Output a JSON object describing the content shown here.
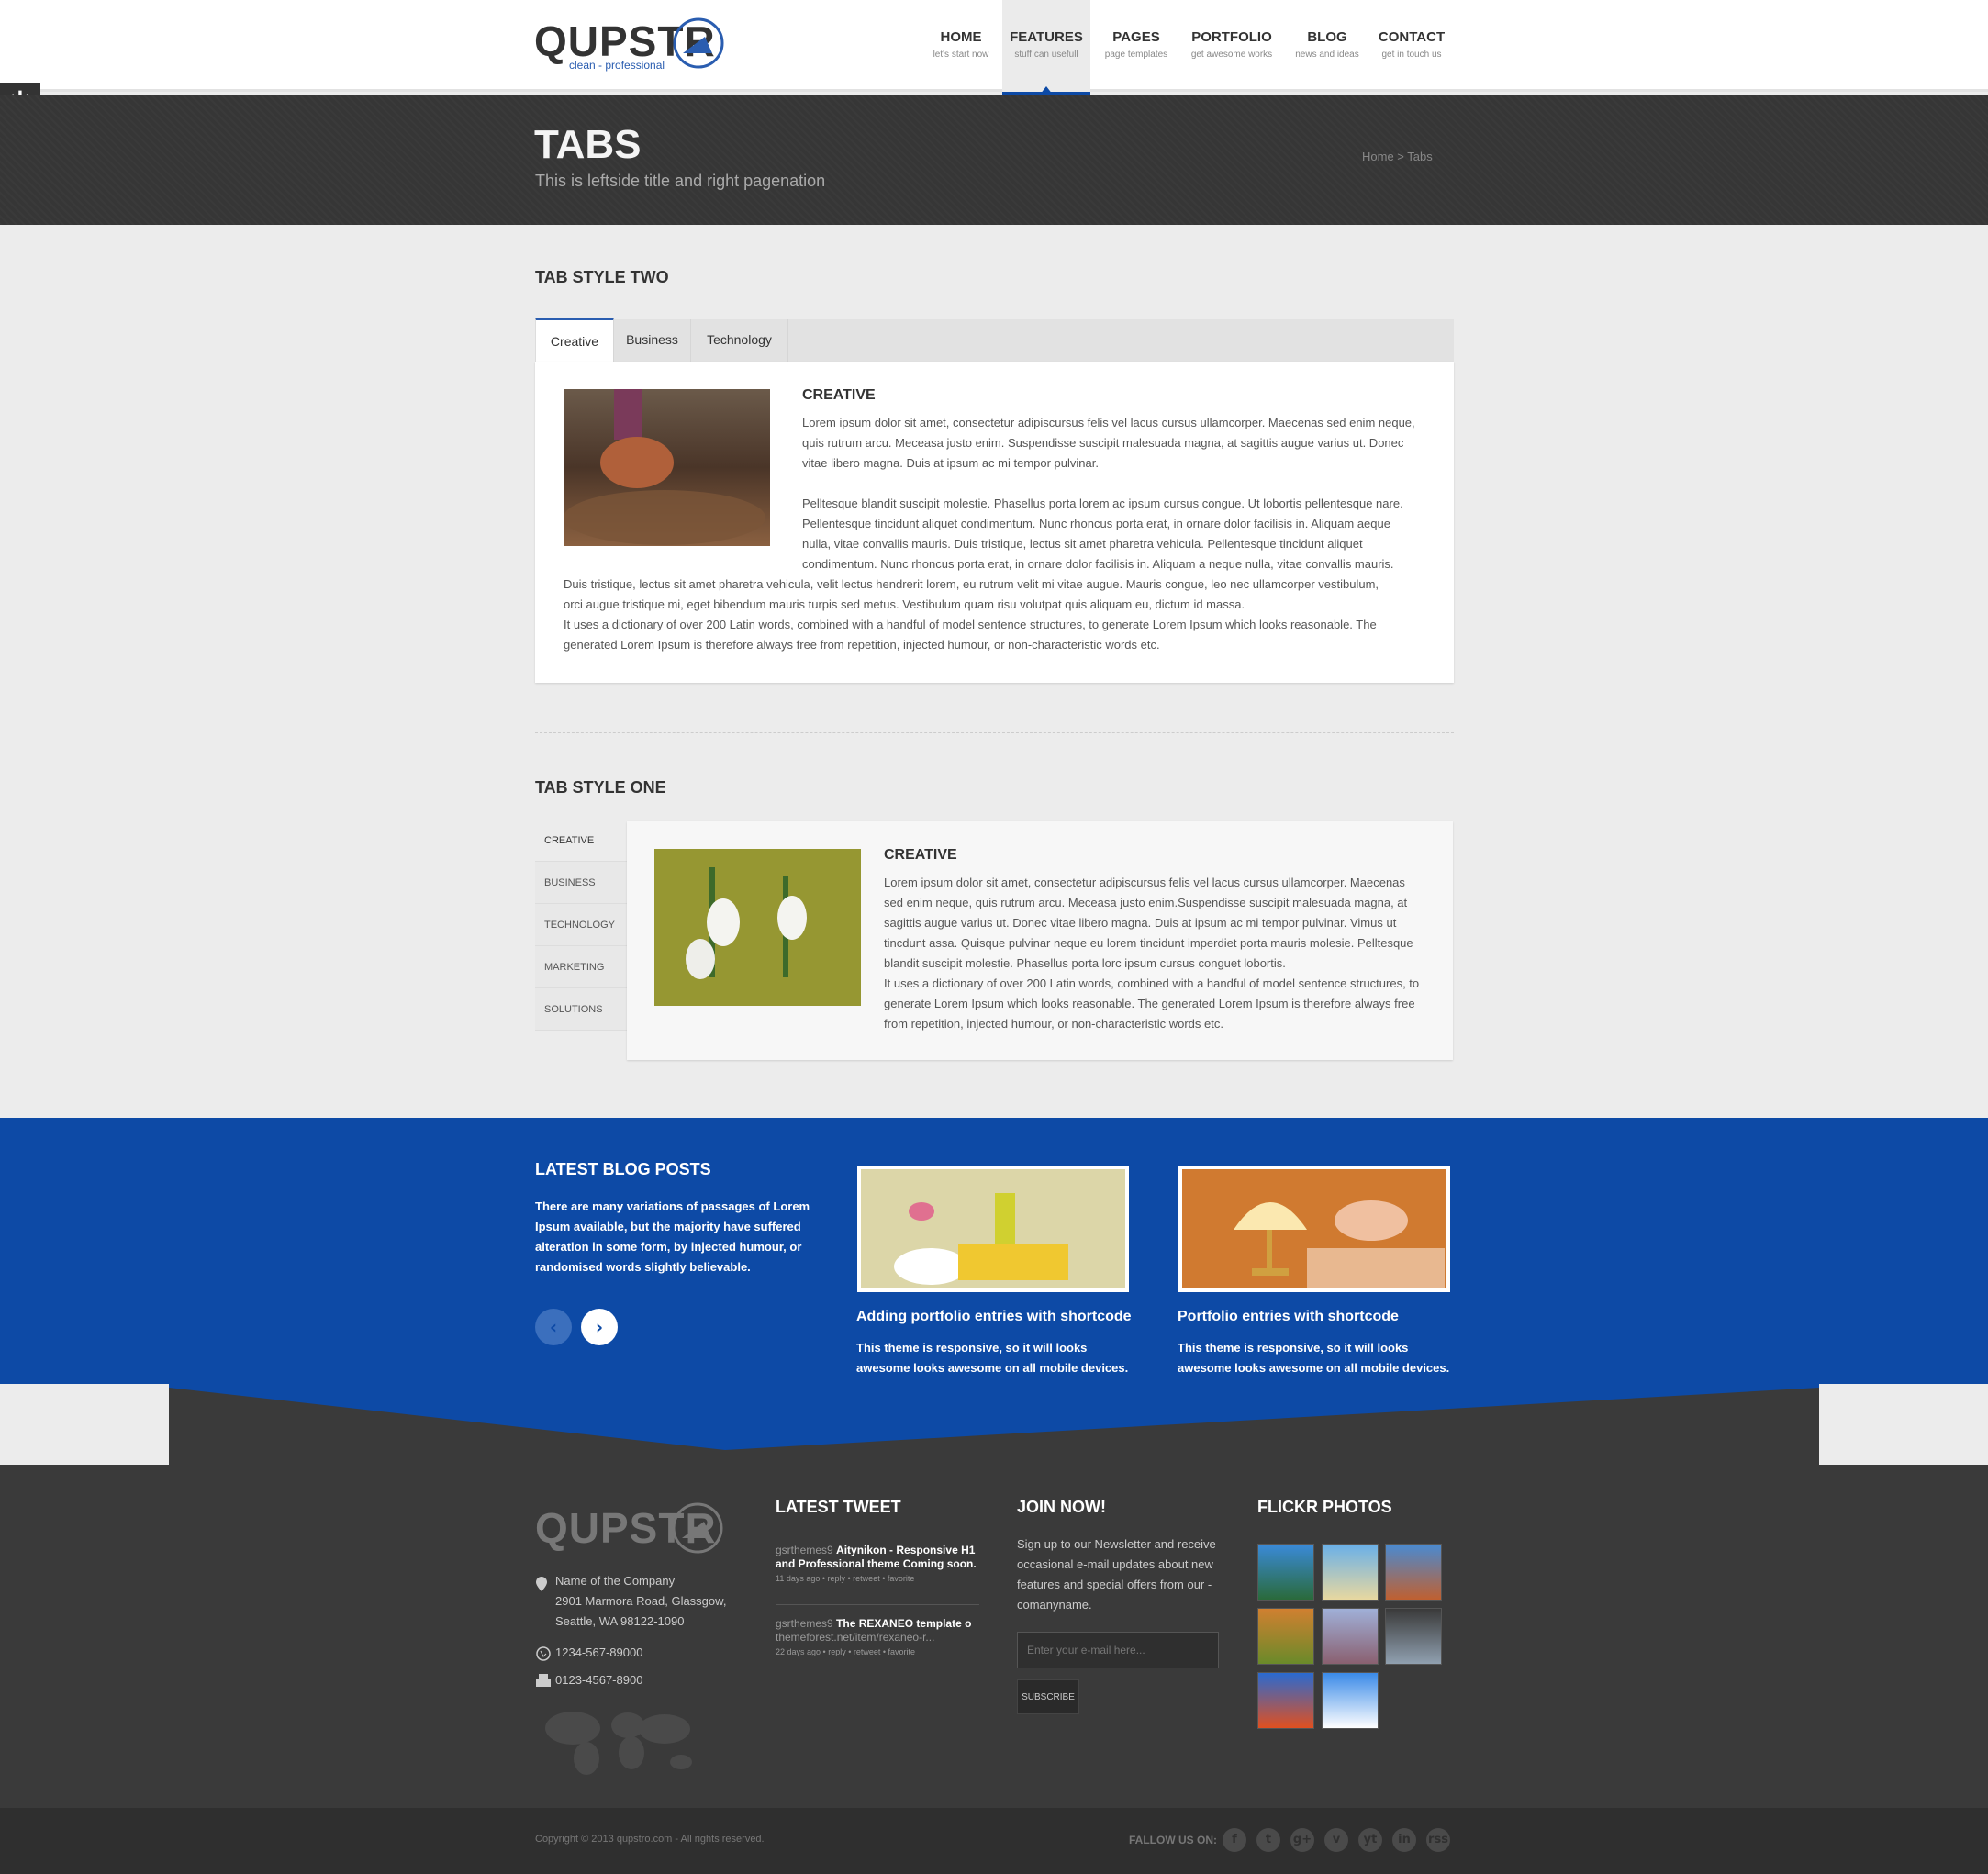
{
  "header": {
    "logo": "QUPSTR",
    "tagline": "clean - professional",
    "nav": [
      {
        "title": "HOME",
        "sub": "let's start now"
      },
      {
        "title": "FEATURES",
        "sub": "stuff can usefull"
      },
      {
        "title": "PAGES",
        "sub": "page templates"
      },
      {
        "title": "PORTFOLIO",
        "sub": "get awesome works"
      },
      {
        "title": "BLOG",
        "sub": "news and ideas"
      },
      {
        "title": "CONTACT",
        "sub": "get in touch us"
      }
    ]
  },
  "banner": {
    "title": "TABS",
    "subtitle": "This is leftside title and right pagenation",
    "breadcrumb": "Home > Tabs"
  },
  "tab_style_two": {
    "heading": "TAB STYLE TWO",
    "tabs": [
      "Creative",
      "Business",
      "Technology"
    ],
    "panel_title": "CREATIVE",
    "p1": "Lorem ipsum dolor sit amet, consectetur adipiscursus felis vel lacus cursus ullamcorper. Maecenas sed enim neque, quis rutrum arcu. Meceasa justo enim. Suspendisse suscipit malesuada magna, at sagittis augue varius ut. Donec vitae libero magna. Duis at ipsum ac mi tempor pulvinar.",
    "p2_lines": [
      "Pelltesque blandit suscipit molestie. Phasellus porta lorem ac ipsum cursus congue. Ut lobortis pellentesque nare.",
      "Pellentesque tincidunt aliquet condimentum. Nunc rhoncus porta erat, in ornare dolor facilisis in. Aliquam aeque",
      "nulla, vitae convallis mauris. Duis tristique, lectus sit amet pharetra vehicula. Pellentesque tincidunt aliquet",
      "condimentum. Nunc rhoncus porta erat, in ornare dolor facilisis in. Aliquam a neque nulla, vitae convallis mauris.",
      "Duis tristique, lectus sit amet pharetra vehicula, velit lectus hendrerit lorem, eu rutrum velit mi vitae augue. Mauris congue, leo nec ullamcorper vestibulum,",
      "orci augue tristique mi, eget bibendum mauris turpis sed metus. Vestibulum quam risu volutpat quis aliquam eu, dictum id massa.",
      "It uses a dictionary of over 200 Latin words, combined with a handful of model sentence structures, to generate Lorem Ipsum which looks reasonable. The",
      "generated Lorem Ipsum is therefore always free from repetition, injected humour, or non-characteristic words etc."
    ]
  },
  "tab_style_one": {
    "heading": "TAB STYLE ONE",
    "tabs": [
      "CREATIVE",
      "BUSINESS",
      "TECHNOLOGY",
      "MARKETING",
      "SOLUTIONS"
    ],
    "panel_title": "CREATIVE",
    "text": "Lorem ipsum dolor sit amet, consectetur adipiscursus felis vel lacus cursus ullamcorper. Maecenas sed enim neque, quis rutrum arcu. Meceasa justo enim.Suspendisse suscipit malesuada magna, at sagittis augue varius ut. Donec vitae libero magna. Duis at ipsum ac mi tempor pulvinar. Vimus ut tincdunt assa. Quisque pulvinar neque eu lorem tincidunt imperdiet porta mauris molesie. Pelltesque blandit suscipit molestie. Phasellus porta lorc ipsum cursus conguet lobortis.",
    "text2": "It uses a dictionary of over 200 Latin words, combined with a handful of model sentence structures, to generate Lorem Ipsum which looks reasonable. The generated Lorem Ipsum is therefore always free from repetition, injected humour, or non-characteristic words etc."
  },
  "blog": {
    "heading": "LATEST BLOG POSTS",
    "intro": "There are many variations of passages of Lorem Ipsum available, but the majority have suffered alteration in some form, by injected humour, or randomised words slightly believable.",
    "posts": [
      {
        "title": "Adding portfolio entries with shortcode",
        "text": "This theme is responsive, so it will looks awesome looks awesome on all mobile devices."
      },
      {
        "title": "Portfolio entries with shortcode",
        "text": "This theme is responsive, so it will looks awesome looks awesome on all mobile devices."
      }
    ],
    "prev": "‹",
    "next": "›"
  },
  "footer": {
    "logo": "QUPSTR",
    "address": [
      "Name of the Company",
      "2901 Marmora Road, Glassgow,",
      "Seattle, WA 98122-1090"
    ],
    "phone": "1234-567-89000",
    "fax": "0123-4567-8900",
    "tweet_heading": "LATEST TWEET",
    "tweets": [
      {
        "user": "gsrthemes9",
        "text": "Aitynikon - Responsive H1",
        "text2": "and Professional theme Coming soon.",
        "meta": "11 days ago • reply • retweet • favorite"
      },
      {
        "user": "gsrthemes9",
        "text": "The REXANEO template o",
        "text2": "themeforest.net/item/rexaneo-r...",
        "meta": "22 days ago • reply • retweet • favorite"
      }
    ],
    "join_heading": "JOIN NOW!",
    "join_text": "Sign up to our Newsletter and receive occasional e-mail updates about new features and special offers from our - comanyname.",
    "email_placeholder": "Enter your e-mail here...",
    "subscribe": "SUBSCRIBE",
    "flickr_heading": "FLICKR PHOTOS",
    "copyright": "Copyright © 2013 qupstro.com - All rights reserved.",
    "follow": "FALLOW US ON:",
    "social": [
      "f",
      "t",
      "g+",
      "v",
      "yt",
      "in",
      "rss"
    ]
  },
  "colors": {
    "accent": "#0d4aa6",
    "dark": "#363636",
    "footer": "#3a3a3a"
  }
}
